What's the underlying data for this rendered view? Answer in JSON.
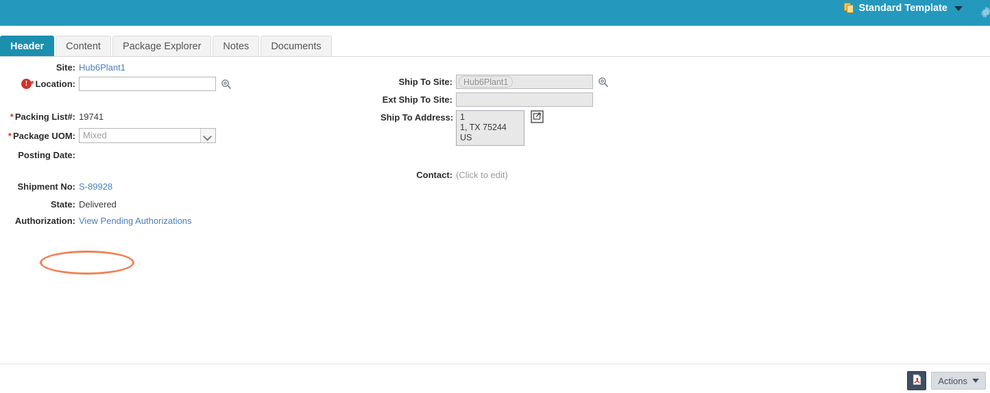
{
  "topbar": {
    "template_label": "Standard Template",
    "template_icon": "copy-pages-icon",
    "caret_icon": "chevron-down-icon",
    "gear_icon": "gear-icon",
    "background_color": "#2499bd"
  },
  "tabs": [
    {
      "label": "Header",
      "active": true
    },
    {
      "label": "Content",
      "active": false
    },
    {
      "label": "Package Explorer",
      "active": false
    },
    {
      "label": "Notes",
      "active": false
    },
    {
      "label": "Documents",
      "active": false
    }
  ],
  "left_column": {
    "site": {
      "label": "Site:",
      "value": "Hub6Plant1"
    },
    "location": {
      "label": "* Location:",
      "label_star": "*",
      "label_text": "Location:",
      "value": "",
      "placeholder": "",
      "error_icon": "error-exclamation-icon",
      "lookup_icon": "magnifier-lookup-icon"
    },
    "packing_list": {
      "label": "* Packing List#:",
      "label_star": "*",
      "label_text": "Packing List#:",
      "value": "19741"
    },
    "package_uom": {
      "label": "* Package UOM:",
      "label_star": "*",
      "label_text": "Package UOM:",
      "value": "Mixed",
      "disabled": true
    },
    "posting_date": {
      "label": "Posting Date:",
      "value": ""
    },
    "shipment_no": {
      "label": "Shipment No:",
      "value": "S-89928"
    },
    "state": {
      "label": "State:",
      "value": "Delivered",
      "highlight_color": "#ef8254"
    },
    "authorization": {
      "label": "Authorization:",
      "value": "View Pending Authorizations"
    }
  },
  "right_column": {
    "ship_to_site": {
      "label": "Ship To Site:",
      "value": "Hub6Plant1",
      "disabled": true,
      "lookup_icon": "magnifier-lookup-icon"
    },
    "ext_ship_to_site": {
      "label": "Ext Ship To Site:",
      "value": "",
      "disabled": true
    },
    "ship_to_address": {
      "label": "Ship To Address:",
      "lines": [
        "1",
        "1, TX 75244",
        "US"
      ],
      "edit_icon": "open-in-window-icon"
    },
    "contact": {
      "label": "Contact:",
      "value": "(Click to edit)"
    }
  },
  "footer": {
    "pdf_label": "pdf-export-icon",
    "actions_label": "Actions",
    "actions_caret": "chevron-down-icon"
  }
}
